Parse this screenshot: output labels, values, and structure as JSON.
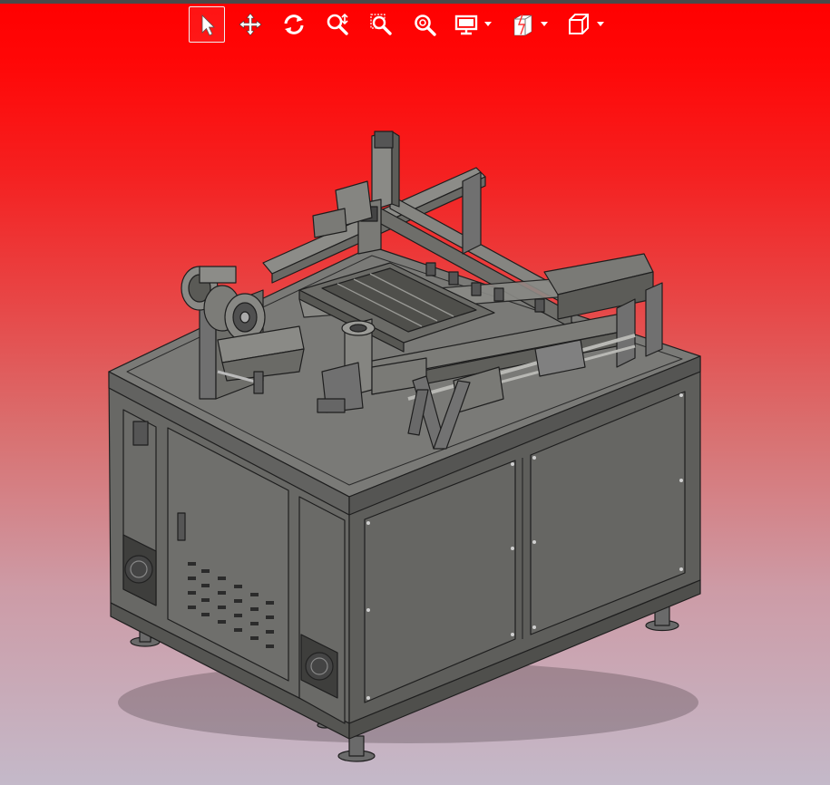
{
  "toolbar": {
    "tools": [
      {
        "id": "select",
        "icon": "select-arrow-icon",
        "active": true
      },
      {
        "id": "pan",
        "icon": "pan-icon",
        "active": false
      },
      {
        "id": "rotate",
        "icon": "rotate-icon",
        "active": false
      },
      {
        "id": "zoom-realtime",
        "icon": "zoom-realtime-icon",
        "active": false
      },
      {
        "id": "zoom-window",
        "icon": "zoom-window-icon",
        "active": false
      },
      {
        "id": "zoom-fit",
        "icon": "zoom-fit-icon",
        "active": false
      },
      {
        "id": "display-style",
        "icon": "display-style-icon",
        "dropdown": true
      },
      {
        "id": "section-view",
        "icon": "section-view-icon",
        "dropdown": true
      },
      {
        "id": "view-orientation",
        "icon": "view-orientation-icon",
        "dropdown": true
      }
    ]
  },
  "viewport": {
    "model": "machine-assembly-3d-model",
    "colors": {
      "background_top": "#ff0000",
      "background_bottom": "#c4b9c9",
      "cabinet_front": "#6f6f6c",
      "cabinet_side": "#5f5f5c",
      "cabinet_top": "#777775",
      "edge": "#1e1e1e",
      "toolbar_icon": "#ffffff"
    }
  }
}
